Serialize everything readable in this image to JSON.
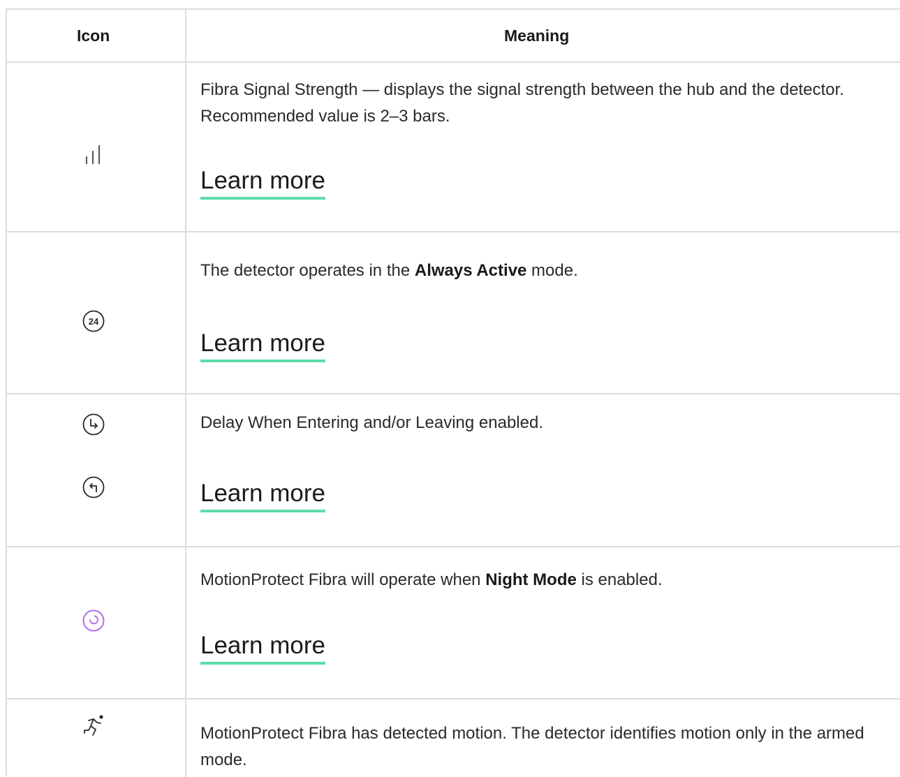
{
  "header": {
    "icon_col": "Icon",
    "meaning_col": "Meaning"
  },
  "rows": [
    {
      "icon": "signal-strength-icon",
      "text": "Fibra Signal Strength — displays the signal strength between the hub and the detector. Recommended value is 2–3 bars.",
      "link": "Learn more"
    },
    {
      "icon": "always-active-24-icon",
      "icon_label": "24",
      "text_before": "The detector operates in the ",
      "text_bold": "Always Active",
      "text_after": " mode.",
      "link": "Learn more"
    },
    {
      "icon": "entry-exit-delay-icons",
      "text": "Delay When Entering and/or Leaving enabled.",
      "link": "Learn more"
    },
    {
      "icon": "night-mode-icon",
      "icon_color": "#b36ef0",
      "text_before": "MotionProtect Fibra will operate when ",
      "text_bold": "Night Mode",
      "text_after": " is enabled.",
      "link": "Learn more"
    },
    {
      "icon": "motion-detected-icon",
      "text": "MotionProtect Fibra has detected motion. The detector identifies motion only in the armed mode."
    }
  ],
  "colors": {
    "border": "#dcdcdc",
    "link_underline": "#5ddcaa"
  }
}
